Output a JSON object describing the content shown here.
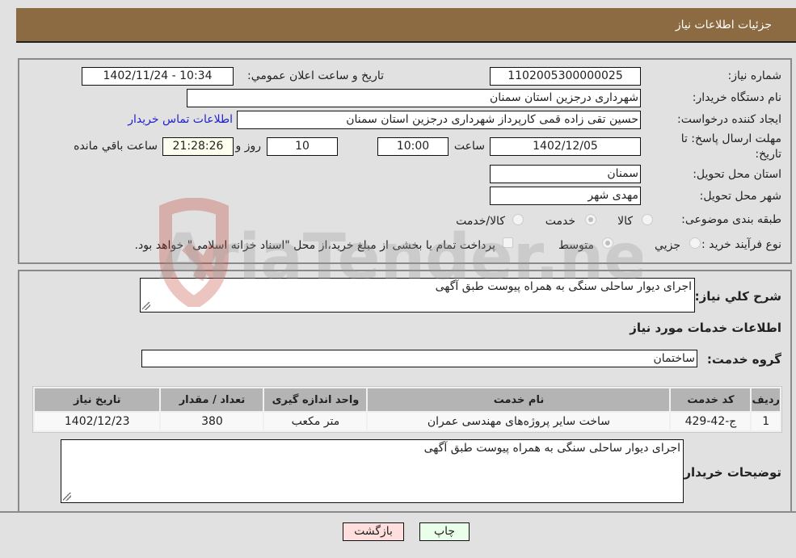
{
  "header": {
    "title": "جزئیات اطلاعات نیاز"
  },
  "details": {
    "need_number_label": "شماره نیاز:",
    "need_number": "1102005300000025",
    "announce_label": "تاریخ و ساعت اعلان عمومي:",
    "announce_value": "1402/11/24 - 10:34",
    "buyer_org_label": "نام دستگاه خریدار:",
    "buyer_org": "شهرداری درجزین استان سمنان",
    "creator_label": "ایجاد کننده درخواست:",
    "creator": "حسین تقی زاده قمی کارپرداز شهرداری درجزین استان سمنان",
    "contact_link": "اطلاعات تماس خریدار",
    "deadline_label": "مهلت ارسال پاسخ: تا تاریخ:",
    "deadline_date": "1402/12/05",
    "time_label": "ساعت",
    "deadline_time": "10:00",
    "days_value": "10",
    "days_label": "روز و",
    "remaining_time": "21:28:26",
    "remaining_label": "ساعت باقي مانده",
    "province_label": "استان محل تحویل:",
    "province": "سمنان",
    "city_label": "شهر محل تحویل:",
    "city": "مهدی شهر",
    "category_label": "طبقه بندی موضوعی:",
    "category_options": [
      {
        "label": "کالا",
        "selected": false
      },
      {
        "label": "خدمت",
        "selected": true
      },
      {
        "label": "کالا/خدمت",
        "selected": false
      }
    ],
    "process_label": "نوع فرآیند خرید :",
    "process_options": [
      {
        "label": "جزيي",
        "selected": false
      },
      {
        "label": "متوسط",
        "selected": true
      }
    ],
    "treasury_checkbox_label": "پرداخت تمام یا بخشی از مبلغ خرید،از محل \"اسناد خزانه اسلامی\" خواهد بود.",
    "treasury_checked": false
  },
  "summary": {
    "description_label": "شرح کلي نیاز:",
    "description": "اجرای دیوار ساحلی سنگی به همراه پیوست طبق آگهی",
    "services_heading": "اطلاعات خدمات مورد نیاز",
    "service_group_label": "گروه خدمت:",
    "service_group": "ساختمان"
  },
  "table": {
    "headers": [
      "ردیف",
      "کد خدمت",
      "نام خدمت",
      "واحد اندازه گیری",
      "تعداد / مقدار",
      "تاریخ نیاز"
    ],
    "rows": [
      [
        "1",
        "ج-42-429",
        "ساخت سایر پروژه‌های مهندسی عمران",
        "متر مکعب",
        "380",
        "1402/12/23"
      ]
    ]
  },
  "buyer_notes": {
    "label": "توضیحات خریدار:",
    "text": "اجرای دیوار ساحلی سنگی به همراه پیوست طبق آگهی"
  },
  "buttons": {
    "print": "چاپ",
    "back": "بازگشت"
  },
  "watermark": {
    "text": "AriaTender.neT"
  },
  "colors": {
    "header_bg": "#8c6a42",
    "link": "#2222cc",
    "back_btn": "#ffdede",
    "print_btn": "#eaffea"
  }
}
